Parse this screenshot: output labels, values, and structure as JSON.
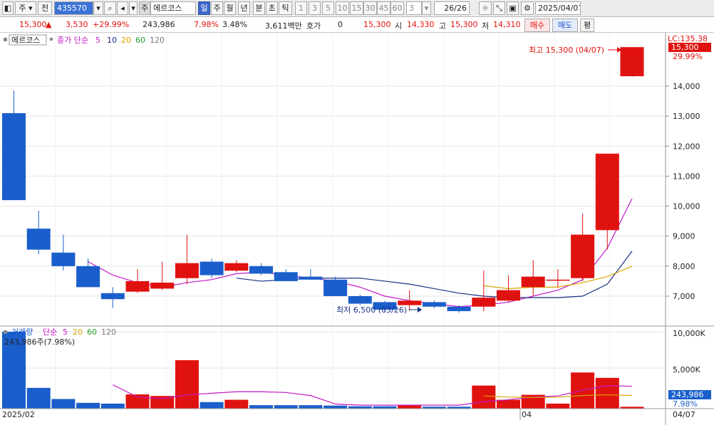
{
  "toolbar": {
    "market": "주",
    "prev": "전",
    "code": "435570",
    "stock_type": "주",
    "stock_name": "에르코스",
    "periods": [
      "일",
      "주",
      "월",
      "년",
      "분",
      "초",
      "틱"
    ],
    "active_period": "일",
    "intervals": [
      "1",
      "3",
      "5",
      "10",
      "15",
      "30",
      "45",
      "60"
    ],
    "interval_value": "3",
    "page": "26/26",
    "date": "2025/04/07"
  },
  "quote": {
    "price": "15,300",
    "change": "3,530",
    "change_rate": "+29.99%",
    "volume": "243,986",
    "vol_ratio": "7.98%",
    "turnover": "3.48%",
    "amount": "3,611백만",
    "hoga_label": "호가",
    "hoga_value": "0",
    "hoga_price": "15,300",
    "open_label": "시",
    "open": "14,330",
    "high_label": "고",
    "high": "15,300",
    "low_label": "저",
    "low": "14,310",
    "buy": "매수",
    "sell": "매도",
    "avg": "평"
  },
  "colors": {
    "up": "#e0120f",
    "down": "#1a5ecc",
    "ma5": "#c419c4",
    "ma10": "#1a2f86",
    "ma20": "#d6a400",
    "ma60": "#2aa02a",
    "text_red": "#e0120f"
  },
  "chart_data": [
    {
      "type": "candlestick",
      "legend": {
        "name": "에르코스",
        "series": "종가 단순",
        "periods": [
          "5",
          "10",
          "20",
          "60",
          "120"
        ]
      },
      "x_labels": [
        "2025/02",
        "04",
        "04/07"
      ],
      "y_ticks": [
        "7,000",
        "8,000",
        "9,000",
        "10,000",
        "11,000",
        "12,000",
        "13,000",
        "14,000"
      ],
      "ylim": [
        6100,
        15300
      ],
      "top_label": "LC:135.38",
      "top_percent": "29.99%",
      "price_tag": "15,300",
      "annotation_high": "최고 15,300 (04/07)",
      "annotation_low": "최저 6,500 (03/26)",
      "candles": [
        {
          "o": 13100,
          "h": 13850,
          "l": 10200,
          "c": 10200
        },
        {
          "o": 9250,
          "h": 9850,
          "l": 8400,
          "c": 8550
        },
        {
          "o": 8450,
          "h": 9050,
          "l": 7850,
          "c": 8000
        },
        {
          "o": 8000,
          "h": 8250,
          "l": 7300,
          "c": 7300
        },
        {
          "o": 7100,
          "h": 7300,
          "l": 6600,
          "c": 6900
        },
        {
          "o": 7150,
          "h": 7900,
          "l": 7100,
          "c": 7500
        },
        {
          "o": 7250,
          "h": 8150,
          "l": 7200,
          "c": 7450
        },
        {
          "o": 7600,
          "h": 9050,
          "l": 7400,
          "c": 8100
        },
        {
          "o": 8150,
          "h": 8250,
          "l": 7600,
          "c": 7700
        },
        {
          "o": 7850,
          "h": 8200,
          "l": 7800,
          "c": 8100
        },
        {
          "o": 8000,
          "h": 8100,
          "l": 7700,
          "c": 7750
        },
        {
          "o": 7800,
          "h": 7900,
          "l": 7500,
          "c": 7500
        },
        {
          "o": 7650,
          "h": 7900,
          "l": 7550,
          "c": 7550
        },
        {
          "o": 7550,
          "h": 7650,
          "l": 7000,
          "c": 7000
        },
        {
          "o": 7000,
          "h": 7050,
          "l": 6700,
          "c": 6750
        },
        {
          "o": 6800,
          "h": 6850,
          "l": 6450,
          "c": 6550
        },
        {
          "o": 6700,
          "h": 7200,
          "l": 6500,
          "c": 6850
        },
        {
          "o": 6800,
          "h": 6850,
          "l": 6600,
          "c": 6650
        },
        {
          "o": 6650,
          "h": 6700,
          "l": 6450,
          "c": 6500
        },
        {
          "o": 6650,
          "h": 7850,
          "l": 6500,
          "c": 6950
        },
        {
          "o": 6850,
          "h": 7700,
          "l": 6800,
          "c": 7200
        },
        {
          "o": 7300,
          "h": 8200,
          "l": 7000,
          "c": 7650
        },
        {
          "o": 7550,
          "h": 7900,
          "l": 7300,
          "c": 7550
        },
        {
          "o": 7600,
          "h": 9750,
          "l": 7500,
          "c": 9050
        },
        {
          "o": 9200,
          "h": 11700,
          "l": 8550,
          "c": 11750
        },
        {
          "o": 14330,
          "h": 15300,
          "l": 14310,
          "c": 15300
        }
      ],
      "ma5": [
        null,
        null,
        null,
        8150,
        7700,
        7450,
        7300,
        7450,
        7550,
        7750,
        7800,
        7700,
        7600,
        7500,
        7300,
        7000,
        6850,
        6750,
        6650,
        6700,
        6800,
        7000,
        7200,
        7550,
        8600,
        10250
      ],
      "ma10": [
        null,
        null,
        null,
        null,
        null,
        null,
        null,
        null,
        null,
        7600,
        7500,
        7550,
        7600,
        7600,
        7600,
        7500,
        7400,
        7250,
        7100,
        7000,
        6950,
        6950,
        6950,
        7000,
        7400,
        8500
      ],
      "ma20": [
        null,
        null,
        null,
        null,
        null,
        null,
        null,
        null,
        null,
        null,
        null,
        null,
        null,
        null,
        null,
        null,
        null,
        null,
        null,
        7350,
        7250,
        7300,
        7300,
        7450,
        7650,
        8000
      ]
    },
    {
      "type": "bar",
      "legend": {
        "name": "거래량",
        "series": "단순",
        "periods": [
          "5",
          "20",
          "60",
          "120"
        ]
      },
      "vol_label": "243,986주(7.98%)",
      "y_ticks": [
        "5,000K",
        "10,000K"
      ],
      "ylim": [
        0,
        10000
      ],
      "bottom_percent": "7.98%",
      "volume_tag": "243,986",
      "volumes": [
        10000,
        2700,
        1250,
        750,
        650,
        1850,
        1650,
        6300,
        850,
        1150,
        450,
        450,
        450,
        400,
        300,
        300,
        450,
        250,
        250,
        3000,
        1150,
        1800,
        650,
        4700,
        4000,
        244
      ],
      "ma5": [
        null,
        null,
        null,
        null,
        3100,
        1500,
        1300,
        1800,
        2000,
        2200,
        2200,
        2100,
        1700,
        600,
        450,
        450,
        450,
        450,
        450,
        900,
        1150,
        1500,
        1650,
        2400,
        3000,
        2900
      ],
      "ma20": [
        null,
        null,
        null,
        null,
        null,
        null,
        null,
        null,
        null,
        null,
        null,
        null,
        null,
        null,
        null,
        null,
        null,
        null,
        null,
        1650,
        1500,
        1450,
        1500,
        1700,
        1800,
        1700
      ]
    }
  ]
}
